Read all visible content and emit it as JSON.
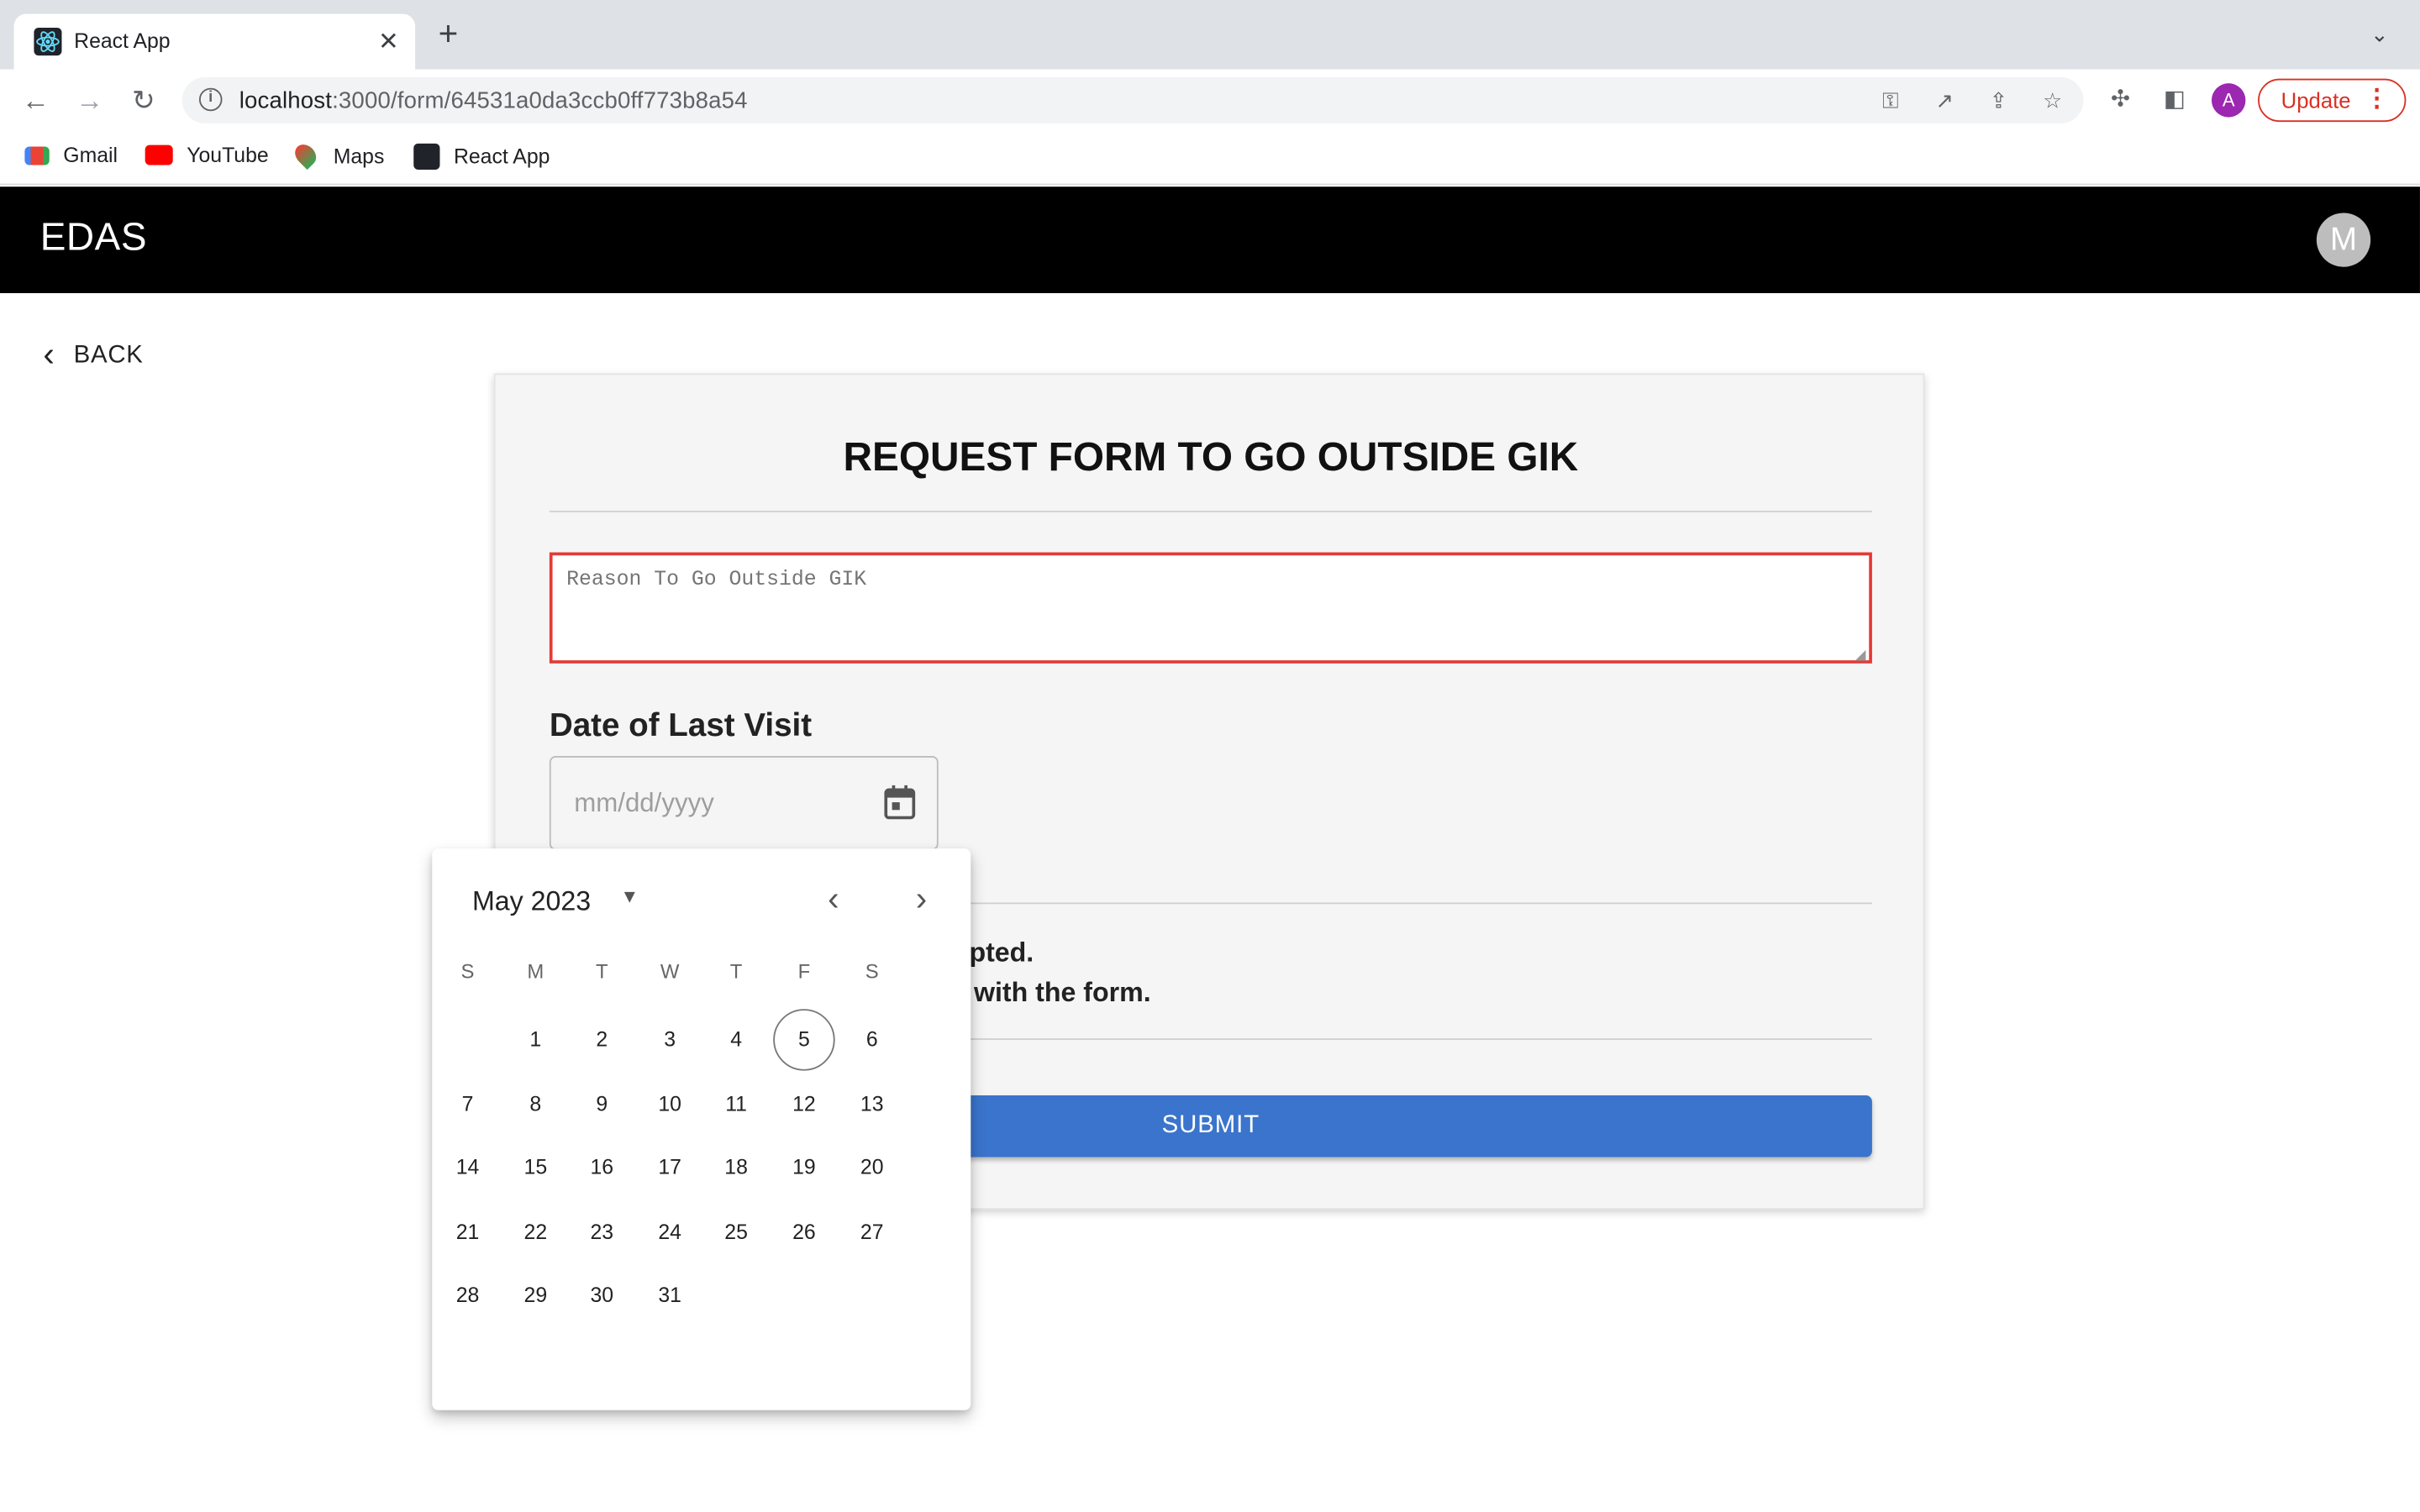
{
  "browser": {
    "tab_title": "React App",
    "url_host": "localhost",
    "url_path": ":3000/form/64531a0da3ccb0ff773b8a54",
    "update_label": "Update",
    "profile_initial": "A",
    "bookmarks": [
      "Gmail",
      "YouTube",
      "Maps",
      "React App"
    ]
  },
  "app": {
    "title": "EDAS",
    "avatar_initial": "M",
    "back_label": "BACK"
  },
  "form": {
    "title": "REQUEST FORM TO GO OUTSIDE GIK",
    "reason_placeholder": "Reason To Go Outside GIK",
    "date_label": "Date of Last Visit",
    "date_placeholder": "mm/dd/yyyy",
    "notice_line1": "pted.",
    "notice_line2": "with the form.",
    "submit_label": "SUBMIT"
  },
  "datepicker": {
    "month_label": "May 2023",
    "weekdays": [
      "S",
      "M",
      "T",
      "W",
      "T",
      "F",
      "S"
    ],
    "first_weekday_index": 1,
    "days_in_month": 31,
    "today": 5
  },
  "colors": {
    "appbar": "#000000",
    "submit": "#3a74cc",
    "error_border": "#e53935"
  }
}
